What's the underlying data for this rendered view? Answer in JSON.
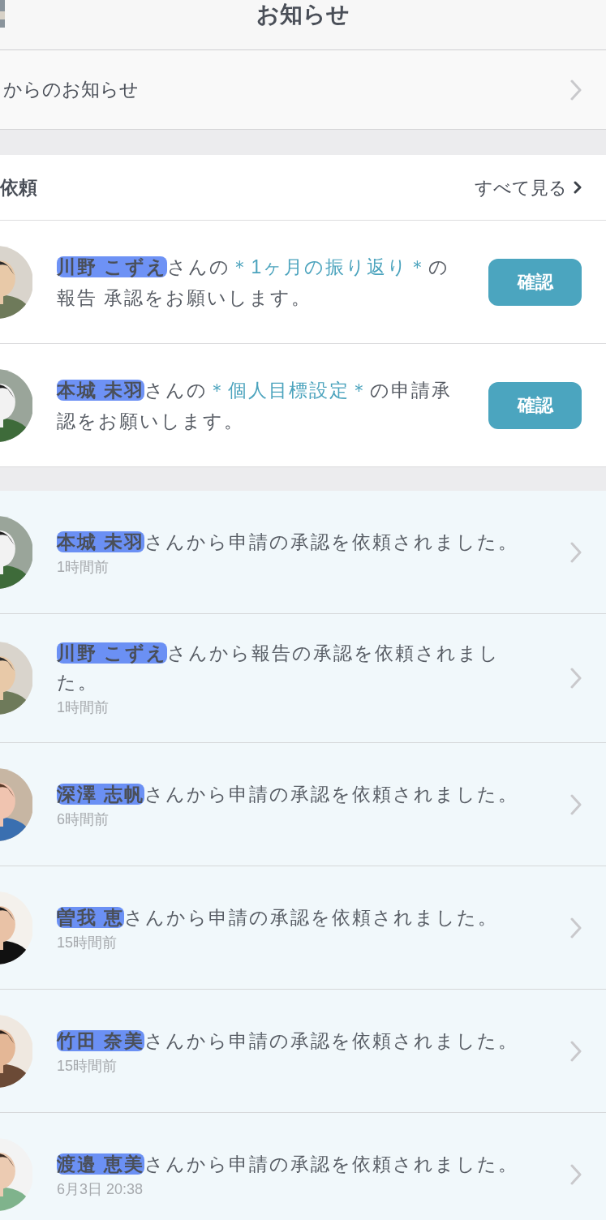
{
  "header": {
    "title": "お知らせ"
  },
  "announcements": {
    "label": "からのお知らせ"
  },
  "requests": {
    "title": "依頼",
    "see_all": "すべて見る",
    "items": [
      {
        "parts": [
          {
            "kind": "name",
            "text": "川野 こずえ"
          },
          {
            "kind": "plain",
            "text": "さんの"
          },
          {
            "kind": "highlight",
            "text": "＊1ヶ月の振り返り＊"
          },
          {
            "kind": "plain",
            "text": "の報告 承認をお願いします。"
          }
        ],
        "button": "確認"
      },
      {
        "parts": [
          {
            "kind": "name",
            "text": "本城 未羽"
          },
          {
            "kind": "plain",
            "text": "さんの"
          },
          {
            "kind": "highlight",
            "text": "＊個人目標設定＊"
          },
          {
            "kind": "plain",
            "text": "の申請承認をお願いします。"
          }
        ],
        "button": "確認"
      }
    ]
  },
  "notifications": [
    {
      "parts": [
        {
          "kind": "name",
          "text": "本城 未羽"
        },
        {
          "kind": "plain",
          "text": "さんから申請の承認を依頼されました。"
        }
      ],
      "time": "1時間前"
    },
    {
      "parts": [
        {
          "kind": "name",
          "text": "川野 こずえ"
        },
        {
          "kind": "plain",
          "text": "さんから報告の承認を依頼されました。"
        }
      ],
      "time": "1時間前"
    },
    {
      "parts": [
        {
          "kind": "name",
          "text": "深澤 志帆"
        },
        {
          "kind": "plain",
          "text": "さんから申請の承認を依頼されました。"
        }
      ],
      "time": "6時間前"
    },
    {
      "parts": [
        {
          "kind": "name",
          "text": "曽我 恵"
        },
        {
          "kind": "plain",
          "text": "さんから申請の承認を依頼されました。"
        }
      ],
      "time": "15時間前"
    },
    {
      "parts": [
        {
          "kind": "name",
          "text": "竹田 奈美"
        },
        {
          "kind": "plain",
          "text": "さんから申請の承認を依頼されました。"
        }
      ],
      "time": "15時間前"
    },
    {
      "parts": [
        {
          "kind": "name",
          "text": "渡邉 恵美"
        },
        {
          "kind": "plain",
          "text": "さんから申請の承認を依頼されました。"
        }
      ],
      "time": "6月3日 20:38"
    }
  ]
}
